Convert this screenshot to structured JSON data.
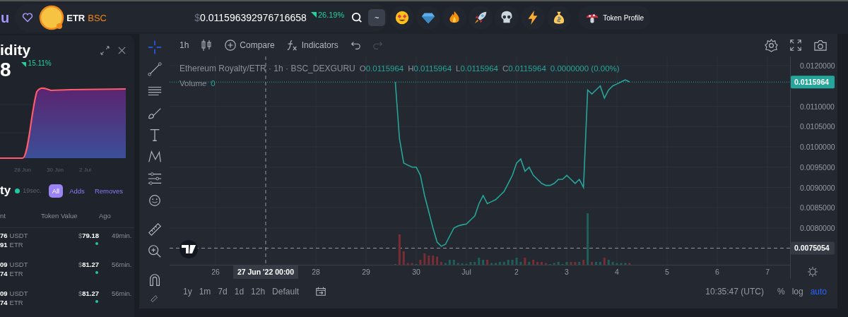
{
  "top_bar": {
    "brand_fragment": "u",
    "token": {
      "symbol": "ETR",
      "chain": "BSC"
    },
    "price": {
      "currency": "$",
      "value": "0.011596392976716658"
    },
    "change": "26.19%",
    "shortcut_key": "~",
    "reactions": [
      {
        "kind": "heart-eyes"
      },
      {
        "kind": "diamond"
      },
      {
        "kind": "fire"
      },
      {
        "kind": "rocket"
      },
      {
        "kind": "skull"
      },
      {
        "kind": "lightning"
      },
      {
        "kind": "money-bag"
      }
    ],
    "profile_button": "Token Profile"
  },
  "liquidity_card": {
    "title": "idity",
    "value": "8",
    "change": "15.11%",
    "axis_labels": [
      "28 Jun",
      "30 Jun",
      "2 Jul"
    ]
  },
  "activity": {
    "title": "ty",
    "updated": "19sec.",
    "filters": [
      {
        "label": "All",
        "selected": true
      },
      {
        "label": "Adds",
        "selected": false
      },
      {
        "label": "Removes",
        "selected": false
      }
    ],
    "columns": [
      "nt",
      "Token Value",
      "Ago"
    ],
    "rows": [
      {
        "amount_1": "76",
        "unit_1": "USDT",
        "amount_2": "91",
        "unit_2": "ETR",
        "currency": "$",
        "value": "79.18",
        "color": "#1fc7a0",
        "ago": "49min."
      },
      {
        "amount_1": "09",
        "unit_1": "USDT",
        "amount_2": "74",
        "unit_2": "ETR",
        "currency": "$",
        "value": "81.27",
        "color": "#1fc7a0",
        "ago": "56min."
      },
      {
        "amount_1": "09",
        "unit_1": "USDT",
        "amount_2": "74",
        "unit_2": "ETR",
        "currency": "$",
        "value": "81.27",
        "color": "#1fc7a0",
        "ago": "56min."
      }
    ]
  },
  "chart": {
    "toolbar": {
      "interval": "1h",
      "compare": "Compare",
      "indicators": "Indicators"
    },
    "legend": {
      "symbol": "Ethereum Royalty/ETR · 1h · BSC_DEXGURU",
      "ohlc": [
        {
          "key": "O",
          "value": "0.0115964"
        },
        {
          "key": "H",
          "value": "0.0115964"
        },
        {
          "key": "L",
          "value": "0.0115964"
        },
        {
          "key": "C",
          "value": "0.0115964"
        }
      ],
      "change": "0.0000000 (0.00%)",
      "volume_label": "Volume",
      "volume_value": "0"
    },
    "chart_data": {
      "type": "line",
      "grid": true,
      "xlim": [
        "2022-06-25T02:02Z",
        "2022-07-07T10:48Z"
      ],
      "ylim": [
        0.007096,
        0.012226
      ],
      "x": [
        "2022-06-29T14:00Z",
        "2022-06-29T16:00Z",
        "2022-06-29T18:00Z",
        "2022-06-29T20:00Z",
        "2022-06-29T22:00Z",
        "2022-06-30T00:00Z",
        "2022-06-30T02:00Z",
        "2022-06-30T04:00Z",
        "2022-06-30T06:00Z",
        "2022-06-30T08:00Z",
        "2022-06-30T10:00Z",
        "2022-06-30T12:00Z",
        "2022-06-30T14:00Z",
        "2022-06-30T16:00Z",
        "2022-06-30T18:00Z",
        "2022-06-30T20:00Z",
        "2022-06-30T22:00Z",
        "2022-07-01T00:00Z",
        "2022-07-01T02:00Z",
        "2022-07-01T04:00Z",
        "2022-07-01T06:00Z",
        "2022-07-01T08:00Z",
        "2022-07-01T10:00Z",
        "2022-07-01T12:00Z",
        "2022-07-01T14:00Z",
        "2022-07-01T16:00Z",
        "2022-07-01T18:00Z",
        "2022-07-01T20:00Z",
        "2022-07-01T22:00Z",
        "2022-07-02T00:00Z",
        "2022-07-02T02:00Z",
        "2022-07-02T04:00Z",
        "2022-07-02T06:00Z",
        "2022-07-02T08:00Z",
        "2022-07-02T10:00Z",
        "2022-07-02T12:00Z",
        "2022-07-02T14:00Z",
        "2022-07-02T16:00Z",
        "2022-07-02T18:00Z",
        "2022-07-02T20:00Z",
        "2022-07-02T22:00Z",
        "2022-07-03T00:00Z",
        "2022-07-03T02:00Z",
        "2022-07-03T04:00Z",
        "2022-07-03T06:00Z",
        "2022-07-03T08:00Z",
        "2022-07-03T10:00Z",
        "2022-07-03T12:00Z",
        "2022-07-03T14:00Z",
        "2022-07-03T16:00Z",
        "2022-07-03T18:00Z",
        "2022-07-03T20:00Z",
        "2022-07-03T22:00Z",
        "2022-07-04T00:00Z",
        "2022-07-04T02:00Z",
        "2022-07-04T04:00Z",
        "2022-07-04T06:00Z"
      ],
      "series": [
        {
          "color": "#26a69a",
          "values": [
            0.0116,
            0.0102,
            0.0096,
            0.00955,
            0.0095,
            0.0095,
            0.0093,
            0.0088,
            0.0084,
            0.008,
            0.00765,
            0.00755,
            0.0076,
            0.0078,
            0.008,
            0.00805,
            0.00808,
            0.0081,
            0.0082,
            0.0083,
            0.0086,
            0.0088,
            0.0086,
            0.00865,
            0.0087,
            0.0088,
            0.0089,
            0.0091,
            0.0093,
            0.0096,
            0.0097,
            0.0094,
            0.0095,
            0.0093,
            0.0092,
            0.0091,
            0.00905,
            0.00905,
            0.0091,
            0.0092,
            0.0092,
            0.0093,
            0.0092,
            0.0091,
            0.0092,
            0.009,
            0.0114,
            0.0113,
            0.0114,
            0.0115,
            0.0112,
            0.0114,
            0.0115,
            0.01155,
            0.0116,
            0.01165,
            0.0116
          ]
        }
      ],
      "xticks": [
        {
          "value": "2022-06-26T00:00Z",
          "label": "26"
        },
        {
          "value": "2022-06-28T00:00Z",
          "label": "28"
        },
        {
          "value": "2022-06-29T00:00Z",
          "label": "29"
        },
        {
          "value": "2022-06-30T00:00Z",
          "label": "30"
        },
        {
          "value": "2022-07-01T00:00Z",
          "label": "Jul"
        },
        {
          "value": "2022-07-02T00:00Z",
          "label": "2"
        },
        {
          "value": "2022-07-03T00:00Z",
          "label": "3"
        },
        {
          "value": "2022-07-04T00:00Z",
          "label": "4"
        },
        {
          "value": "2022-07-05T00:00Z",
          "label": "5"
        },
        {
          "value": "2022-07-06T00:00Z",
          "label": "6"
        },
        {
          "value": "2022-07-07T00:00Z",
          "label": "7"
        }
      ],
      "yticks": [
        {
          "value": 0.012,
          "label": "0.0120000"
        },
        {
          "value": 0.011,
          "label": "0.0110000"
        },
        {
          "value": 0.0105,
          "label": "0.0105000"
        },
        {
          "value": 0.01,
          "label": "0.0100000"
        },
        {
          "value": 0.0095,
          "label": "0.0095000"
        },
        {
          "value": 0.009,
          "label": "0.0090000"
        },
        {
          "value": 0.0085,
          "label": "0.0085000"
        },
        {
          "value": 0.008,
          "label": "0.0080000"
        }
      ],
      "ref_lines": [
        {
          "axis": "x",
          "value": "2022-06-27T00:00Z",
          "label": "27 Jun '22  00:00",
          "color": "#9598a1"
        },
        {
          "axis": "y",
          "value": 0.0075054,
          "label": "0.0075054",
          "color": "#9598a1"
        },
        {
          "axis": "y",
          "value": 0.0115964,
          "label": "0.0115964",
          "color": "#26a69a"
        }
      ]
    },
    "ranges": [
      "1y",
      "1m",
      "7d",
      "1d",
      "12h",
      "Default"
    ],
    "clock": "10:35:47 (UTC)",
    "scale_options": [
      {
        "label": "%",
        "selected": false
      },
      {
        "label": "log",
        "selected": false
      },
      {
        "label": "auto",
        "selected": true
      }
    ]
  }
}
